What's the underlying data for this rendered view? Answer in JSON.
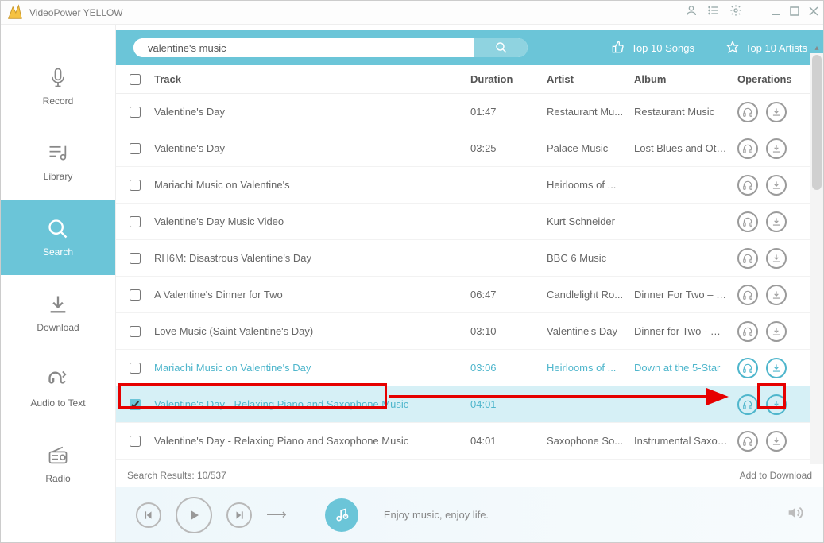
{
  "app": {
    "title": "VideoPower YELLOW"
  },
  "sidebar": {
    "items": [
      {
        "label": "Record"
      },
      {
        "label": "Library"
      },
      {
        "label": "Search"
      },
      {
        "label": "Download"
      },
      {
        "label": "Audio to Text"
      },
      {
        "label": "Radio"
      }
    ]
  },
  "search": {
    "value": "valentine's music"
  },
  "toplinks": {
    "songs": "Top 10 Songs",
    "artists": "Top 10 Artists"
  },
  "headers": {
    "track": "Track",
    "duration": "Duration",
    "artist": "Artist",
    "album": "Album",
    "operations": "Operations"
  },
  "rows": [
    {
      "track": "Valentine's Day",
      "duration": "01:47",
      "artist": "Restaurant Mu...",
      "album": "Restaurant Music"
    },
    {
      "track": "Valentine's Day",
      "duration": "03:25",
      "artist": "Palace Music",
      "album": "Lost Blues and Othe..."
    },
    {
      "track": "Mariachi Music on Valentine's",
      "duration": "",
      "artist": "Heirlooms of ...",
      "album": ""
    },
    {
      "track": "Valentine's Day Music Video",
      "duration": "",
      "artist": "Kurt Schneider",
      "album": ""
    },
    {
      "track": "RH6M: Disastrous Valentine's Day",
      "duration": "",
      "artist": "BBC 6 Music",
      "album": ""
    },
    {
      "track": "A Valentine's Dinner for Two",
      "duration": "06:47",
      "artist": "Candlelight Ro...",
      "album": "Dinner For Two –  Be..."
    },
    {
      "track": "Love Music (Saint Valentine's Day)",
      "duration": "03:10",
      "artist": "Valentine's Day",
      "album": "Dinner for Two - Ro..."
    },
    {
      "track": "Mariachi Music on Valentine's Day",
      "duration": "03:06",
      "artist": "Heirlooms of ...",
      "album": "Down at the 5-Star"
    },
    {
      "track": "Valentine's Day - Relaxing Piano and Saxophone Music",
      "duration": "04:01",
      "artist": "",
      "album": ""
    },
    {
      "track": "Valentine's Day - Relaxing Piano and Saxophone Music",
      "duration": "04:01",
      "artist": "Saxophone So...",
      "album": "Instrumental Saxop..."
    }
  ],
  "status": {
    "results": "Search Results: 10/537",
    "add": "Add to Download"
  },
  "player": {
    "nowplaying": "Enjoy music, enjoy life."
  }
}
